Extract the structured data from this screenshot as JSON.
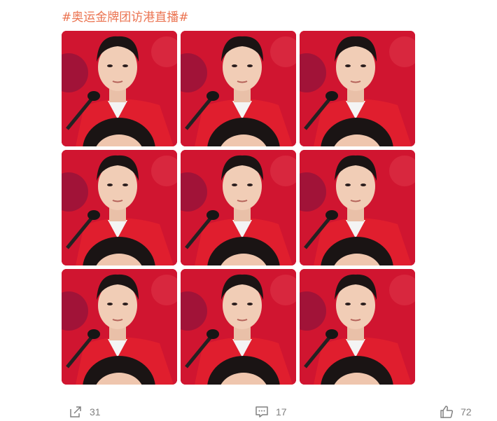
{
  "post": {
    "hashtag": "#奥运金牌团访港直播#",
    "photos": [
      {
        "variant": "a"
      },
      {
        "variant": "b"
      },
      {
        "variant": "c"
      },
      {
        "variant": "a"
      },
      {
        "variant": "b"
      },
      {
        "variant": "a"
      },
      {
        "variant": "a"
      },
      {
        "variant": "b"
      },
      {
        "variant": "a"
      }
    ]
  },
  "actions": {
    "repost": {
      "icon": "share-icon",
      "count": "31"
    },
    "comment": {
      "icon": "comment-icon",
      "count": "17"
    },
    "like": {
      "icon": "thumbs-up-icon",
      "count": "72"
    }
  },
  "colors": {
    "hashtag": "#eb7350",
    "photo_background": "#c8102e",
    "action_text": "#808080"
  }
}
